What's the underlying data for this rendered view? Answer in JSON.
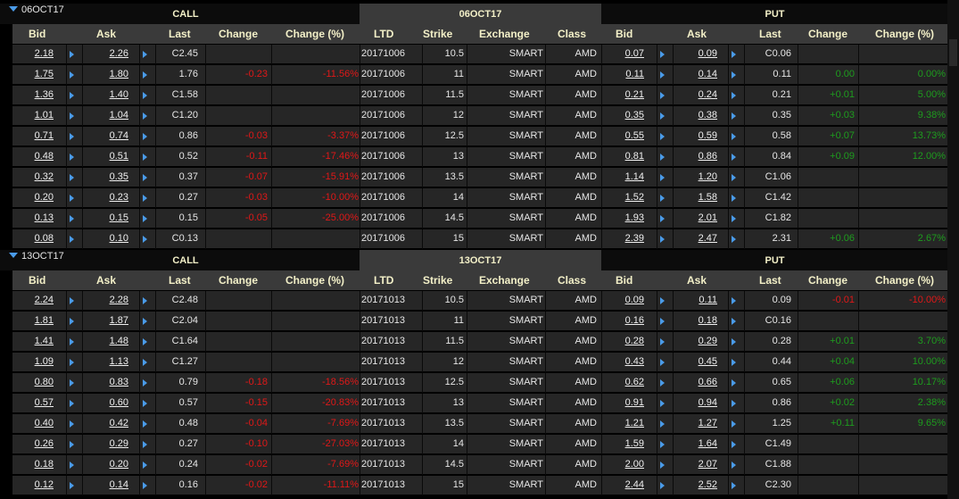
{
  "colors": {
    "accent": "#4a9be8",
    "negative": "#e01818",
    "positive": "#1e9c1e"
  },
  "columns": {
    "bid": "Bid",
    "ask": "Ask",
    "last": "Last",
    "change": "Change",
    "change_pct": "Change (%)",
    "ltd": "LTD",
    "strike": "Strike",
    "exchange": "Exchange",
    "class": "Class"
  },
  "sections": [
    {
      "expiry_label": "06OCT17",
      "call_label": "CALL",
      "mid_label": "06OCT17",
      "put_label": "PUT",
      "rows": [
        {
          "cbid": "2.18",
          "cask": "2.26",
          "clast": "C2.45",
          "cchg": "",
          "cpct": "",
          "ltd": "20171006",
          "strike": "10.5",
          "exch": "SMART",
          "cls": "AMD",
          "pbid": "0.07",
          "pask": "0.09",
          "plast": "C0.06",
          "pchg": "",
          "ppct": ""
        },
        {
          "cbid": "1.75",
          "cask": "1.80",
          "clast": "1.76",
          "cchg": "-0.23",
          "cpct": "-11.56%",
          "ltd": "20171006",
          "strike": "11",
          "exch": "SMART",
          "cls": "AMD",
          "pbid": "0.11",
          "pask": "0.14",
          "plast": "0.11",
          "pchg": "0.00",
          "ppct": "0.00%"
        },
        {
          "cbid": "1.36",
          "cask": "1.40",
          "clast": "C1.58",
          "cchg": "",
          "cpct": "",
          "ltd": "20171006",
          "strike": "11.5",
          "exch": "SMART",
          "cls": "AMD",
          "pbid": "0.21",
          "pask": "0.24",
          "plast": "0.21",
          "pchg": "+0.01",
          "ppct": "5.00%"
        },
        {
          "cbid": "1.01",
          "cask": "1.04",
          "clast": "C1.20",
          "cchg": "",
          "cpct": "",
          "ltd": "20171006",
          "strike": "12",
          "exch": "SMART",
          "cls": "AMD",
          "pbid": "0.35",
          "pask": "0.38",
          "plast": "0.35",
          "pchg": "+0.03",
          "ppct": "9.38%"
        },
        {
          "cbid": "0.71",
          "cask": "0.74",
          "clast": "0.86",
          "cchg": "-0.03",
          "cpct": "-3.37%",
          "ltd": "20171006",
          "strike": "12.5",
          "exch": "SMART",
          "cls": "AMD",
          "pbid": "0.55",
          "pask": "0.59",
          "plast": "0.58",
          "pchg": "+0.07",
          "ppct": "13.73%"
        },
        {
          "cbid": "0.48",
          "cask": "0.51",
          "clast": "0.52",
          "cchg": "-0.11",
          "cpct": "-17.46%",
          "ltd": "20171006",
          "strike": "13",
          "exch": "SMART",
          "cls": "AMD",
          "pbid": "0.81",
          "pask": "0.86",
          "plast": "0.84",
          "pchg": "+0.09",
          "ppct": "12.00%"
        },
        {
          "cbid": "0.32",
          "cask": "0.35",
          "clast": "0.37",
          "cchg": "-0.07",
          "cpct": "-15.91%",
          "ltd": "20171006",
          "strike": "13.5",
          "exch": "SMART",
          "cls": "AMD",
          "pbid": "1.14",
          "pask": "1.20",
          "plast": "C1.06",
          "pchg": "",
          "ppct": ""
        },
        {
          "cbid": "0.20",
          "cask": "0.23",
          "clast": "0.27",
          "cchg": "-0.03",
          "cpct": "-10.00%",
          "ltd": "20171006",
          "strike": "14",
          "exch": "SMART",
          "cls": "AMD",
          "pbid": "1.52",
          "pask": "1.58",
          "plast": "C1.42",
          "pchg": "",
          "ppct": ""
        },
        {
          "cbid": "0.13",
          "cask": "0.15",
          "clast": "0.15",
          "cchg": "-0.05",
          "cpct": "-25.00%",
          "ltd": "20171006",
          "strike": "14.5",
          "exch": "SMART",
          "cls": "AMD",
          "pbid": "1.93",
          "pask": "2.01",
          "plast": "C1.82",
          "pchg": "",
          "ppct": ""
        },
        {
          "cbid": "0.08",
          "cask": "0.10",
          "clast": "C0.13",
          "cchg": "",
          "cpct": "",
          "ltd": "20171006",
          "strike": "15",
          "exch": "SMART",
          "cls": "AMD",
          "pbid": "2.39",
          "pask": "2.47",
          "plast": "2.31",
          "pchg": "+0.06",
          "ppct": "2.67%"
        }
      ]
    },
    {
      "expiry_label": "13OCT17",
      "call_label": "CALL",
      "mid_label": "13OCT17",
      "put_label": "PUT",
      "rows": [
        {
          "cbid": "2.24",
          "cask": "2.28",
          "clast": "C2.48",
          "cchg": "",
          "cpct": "",
          "ltd": "20171013",
          "strike": "10.5",
          "exch": "SMART",
          "cls": "AMD",
          "pbid": "0.09",
          "pask": "0.11",
          "plast": "0.09",
          "pchg": "-0.01",
          "ppct": "-10.00%"
        },
        {
          "cbid": "1.81",
          "cask": "1.87",
          "clast": "C2.04",
          "cchg": "",
          "cpct": "",
          "ltd": "20171013",
          "strike": "11",
          "exch": "SMART",
          "cls": "AMD",
          "pbid": "0.16",
          "pask": "0.18",
          "plast": "C0.16",
          "pchg": "",
          "ppct": ""
        },
        {
          "cbid": "1.41",
          "cask": "1.48",
          "clast": "C1.64",
          "cchg": "",
          "cpct": "",
          "ltd": "20171013",
          "strike": "11.5",
          "exch": "SMART",
          "cls": "AMD",
          "pbid": "0.28",
          "pask": "0.29",
          "plast": "0.28",
          "pchg": "+0.01",
          "ppct": "3.70%"
        },
        {
          "cbid": "1.09",
          "cask": "1.13",
          "clast": "C1.27",
          "cchg": "",
          "cpct": "",
          "ltd": "20171013",
          "strike": "12",
          "exch": "SMART",
          "cls": "AMD",
          "pbid": "0.43",
          "pask": "0.45",
          "plast": "0.44",
          "pchg": "+0.04",
          "ppct": "10.00%"
        },
        {
          "cbid": "0.80",
          "cask": "0.83",
          "clast": "0.79",
          "cchg": "-0.18",
          "cpct": "-18.56%",
          "ltd": "20171013",
          "strike": "12.5",
          "exch": "SMART",
          "cls": "AMD",
          "pbid": "0.62",
          "pask": "0.66",
          "plast": "0.65",
          "pchg": "+0.06",
          "ppct": "10.17%"
        },
        {
          "cbid": "0.57",
          "cask": "0.60",
          "clast": "0.57",
          "cchg": "-0.15",
          "cpct": "-20.83%",
          "ltd": "20171013",
          "strike": "13",
          "exch": "SMART",
          "cls": "AMD",
          "pbid": "0.91",
          "pask": "0.94",
          "plast": "0.86",
          "pchg": "+0.02",
          "ppct": "2.38%"
        },
        {
          "cbid": "0.40",
          "cask": "0.42",
          "clast": "0.48",
          "cchg": "-0.04",
          "cpct": "-7.69%",
          "ltd": "20171013",
          "strike": "13.5",
          "exch": "SMART",
          "cls": "AMD",
          "pbid": "1.21",
          "pask": "1.27",
          "plast": "1.25",
          "pchg": "+0.11",
          "ppct": "9.65%"
        },
        {
          "cbid": "0.26",
          "cask": "0.29",
          "clast": "0.27",
          "cchg": "-0.10",
          "cpct": "-27.03%",
          "ltd": "20171013",
          "strike": "14",
          "exch": "SMART",
          "cls": "AMD",
          "pbid": "1.59",
          "pask": "1.64",
          "plast": "C1.49",
          "pchg": "",
          "ppct": ""
        },
        {
          "cbid": "0.18",
          "cask": "0.20",
          "clast": "0.24",
          "cchg": "-0.02",
          "cpct": "-7.69%",
          "ltd": "20171013",
          "strike": "14.5",
          "exch": "SMART",
          "cls": "AMD",
          "pbid": "2.00",
          "pask": "2.07",
          "plast": "C1.88",
          "pchg": "",
          "ppct": ""
        },
        {
          "cbid": "0.12",
          "cask": "0.14",
          "clast": "0.16",
          "cchg": "-0.02",
          "cpct": "-11.11%",
          "ltd": "20171013",
          "strike": "15",
          "exch": "SMART",
          "cls": "AMD",
          "pbid": "2.44",
          "pask": "2.52",
          "plast": "C2.30",
          "pchg": "",
          "ppct": ""
        }
      ]
    }
  ]
}
